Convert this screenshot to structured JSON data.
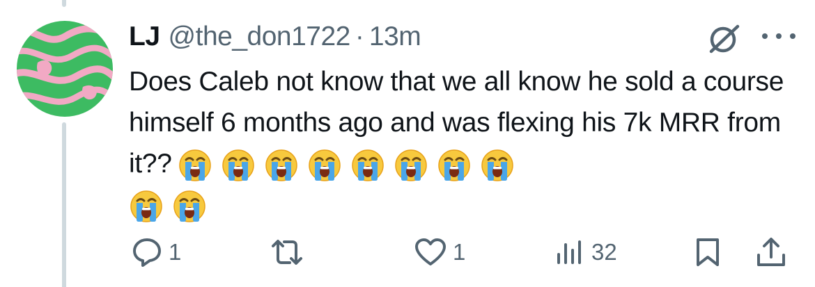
{
  "tweet": {
    "author_name": "LJ",
    "author_handle": "@the_don1722",
    "separator": "·",
    "timestamp": "13m",
    "text": "Does Caleb not know that we all know he sold a course himself 6 months ago and was flexing his 7k MRR from it??",
    "emoji": "loudly-crying-face",
    "emoji_count": 10
  },
  "actions": {
    "replies": "1",
    "likes": "1",
    "views": "32"
  },
  "colors": {
    "avatar_green": "#3dbb62",
    "avatar_pink": "#f2a9c4",
    "muted_text": "#536471",
    "thread_line": "#cfd9de"
  },
  "icons": [
    "grok-icon",
    "more-icon",
    "reply-icon",
    "retweet-icon",
    "like-icon",
    "views-icon",
    "bookmark-icon",
    "share-icon"
  ]
}
